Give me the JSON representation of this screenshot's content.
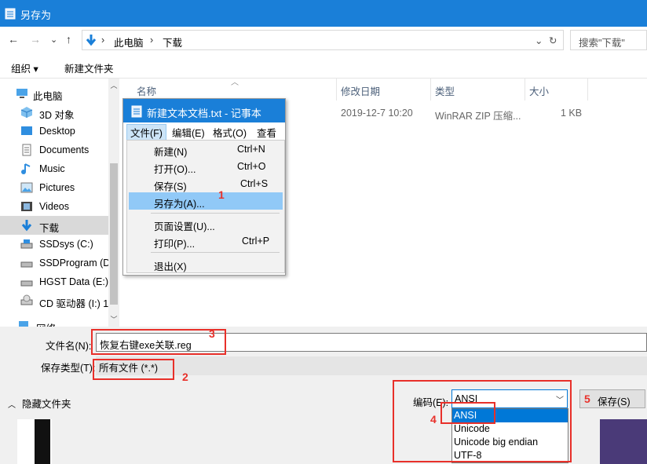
{
  "window": {
    "title": "另存为"
  },
  "address": {
    "back": "←",
    "forward": "→",
    "dropdown": "⌄",
    "up": "↑",
    "crumb1": "此电脑",
    "sep": "›",
    "crumb2": "下载",
    "crumb_drop": "⌄",
    "refresh": "↻",
    "search_placeholder": "搜索\"下载\""
  },
  "toolbar": {
    "organize": "组织 ▾",
    "new_folder": "新建文件夹"
  },
  "nav": {
    "items": [
      {
        "label": "此电脑",
        "icon": "computer-icon"
      },
      {
        "label": "3D 对象",
        "icon": "cube-icon"
      },
      {
        "label": "Desktop",
        "icon": "desktop-icon"
      },
      {
        "label": "Documents",
        "icon": "document-icon"
      },
      {
        "label": "Music",
        "icon": "music-icon"
      },
      {
        "label": "Pictures",
        "icon": "picture-icon"
      },
      {
        "label": "Videos",
        "icon": "video-icon"
      },
      {
        "label": "下载",
        "icon": "download-icon"
      },
      {
        "label": "SSDsys (C:)",
        "icon": "drive-icon"
      },
      {
        "label": "SSDProgram (D",
        "icon": "drive-icon"
      },
      {
        "label": "HGST Data (E:)",
        "icon": "drive-icon"
      },
      {
        "label": "CD 驱动器 (I:) 1",
        "icon": "cd-icon"
      },
      {
        "label": "网络",
        "icon": "network-icon"
      }
    ]
  },
  "files": {
    "columns": [
      "名称",
      "修改日期",
      "类型",
      "大小"
    ],
    "rows": [
      {
        "date": "2019-12-7 10:20",
        "type": "WinRAR ZIP 压缩...",
        "size": "1 KB"
      }
    ]
  },
  "notepad": {
    "title": "新建文本文档.txt - 记事本",
    "menus": [
      "文件(F)",
      "编辑(E)",
      "格式(O)",
      "查看(V"
    ],
    "file_menu": [
      {
        "label": "新建(N)",
        "key": "Ctrl+N"
      },
      {
        "label": "打开(O)...",
        "key": "Ctrl+O"
      },
      {
        "label": "保存(S)",
        "key": "Ctrl+S"
      },
      {
        "label": "另存为(A)...",
        "key": ""
      },
      {
        "label": "页面设置(U)...",
        "key": ""
      },
      {
        "label": "打印(P)...",
        "key": "Ctrl+P"
      },
      {
        "label": "退出(X)",
        "key": ""
      }
    ]
  },
  "form": {
    "filename_label": "文件名(N):",
    "filename_value": "恢复右键exe关联.reg",
    "type_label": "保存类型(T):",
    "type_value": "所有文件 (*.*)",
    "hide_folders": "隐藏文件夹",
    "encoding_label": "编码(E):",
    "encoding_value": "ANSI",
    "encoding_options": [
      "ANSI",
      "Unicode",
      "Unicode big endian",
      "UTF-8"
    ],
    "save_button": "保存(S)"
  },
  "annotations": [
    "1",
    "2",
    "3",
    "4",
    "5"
  ],
  "colors": {
    "accent": "#1a7fd8",
    "highlight": "#91c9f7",
    "annotation": "#e8302a"
  }
}
